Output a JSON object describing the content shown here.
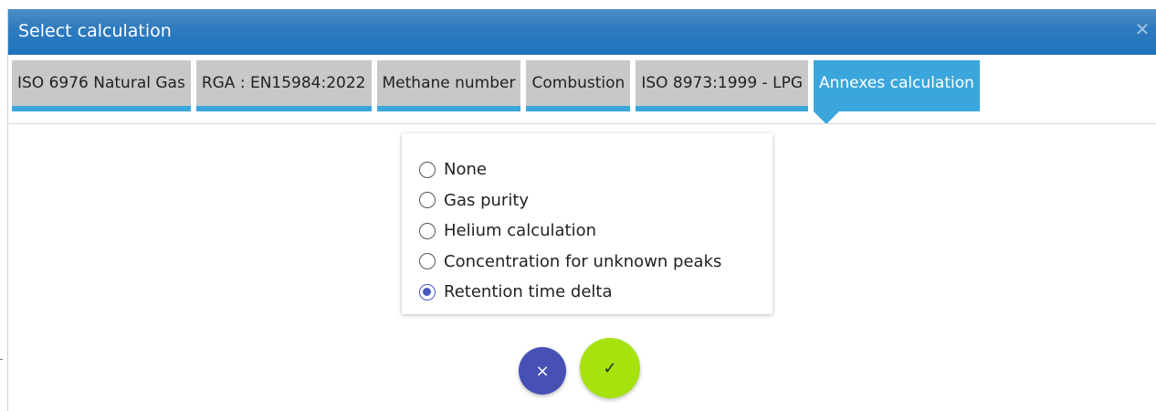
{
  "dialog": {
    "title": "Select calculation",
    "close_icon": "close-icon"
  },
  "tabs": [
    {
      "label": "ISO 6976 Natural Gas",
      "active": false
    },
    {
      "label": "RGA : EN15984:2022",
      "active": false
    },
    {
      "label": "Methane number",
      "active": false
    },
    {
      "label": "Combustion",
      "active": false
    },
    {
      "label": "ISO 8973:1999 - LPG",
      "active": false
    },
    {
      "label": "Annexes calculation",
      "active": true
    }
  ],
  "options": [
    {
      "label": "None",
      "checked": false
    },
    {
      "label": "Gas purity",
      "checked": false
    },
    {
      "label": "Helium calculation",
      "checked": false
    },
    {
      "label": "Concentration for unknown peaks",
      "checked": false
    },
    {
      "label": "Retention time delta",
      "checked": true
    }
  ],
  "actions": {
    "cancel_icon": "close-icon",
    "confirm_icon": "check-icon"
  },
  "glyphs": {
    "close": "✕",
    "check": "✓",
    "times": "×"
  },
  "colors": {
    "title_bar": "#2f7bbf",
    "tab_accent": "#3ba6dc",
    "tab_inactive": "#c8c8c8",
    "radio_checked": "#4759c4",
    "cancel_button": "#4750b5",
    "confirm_button": "#a7e20e"
  }
}
